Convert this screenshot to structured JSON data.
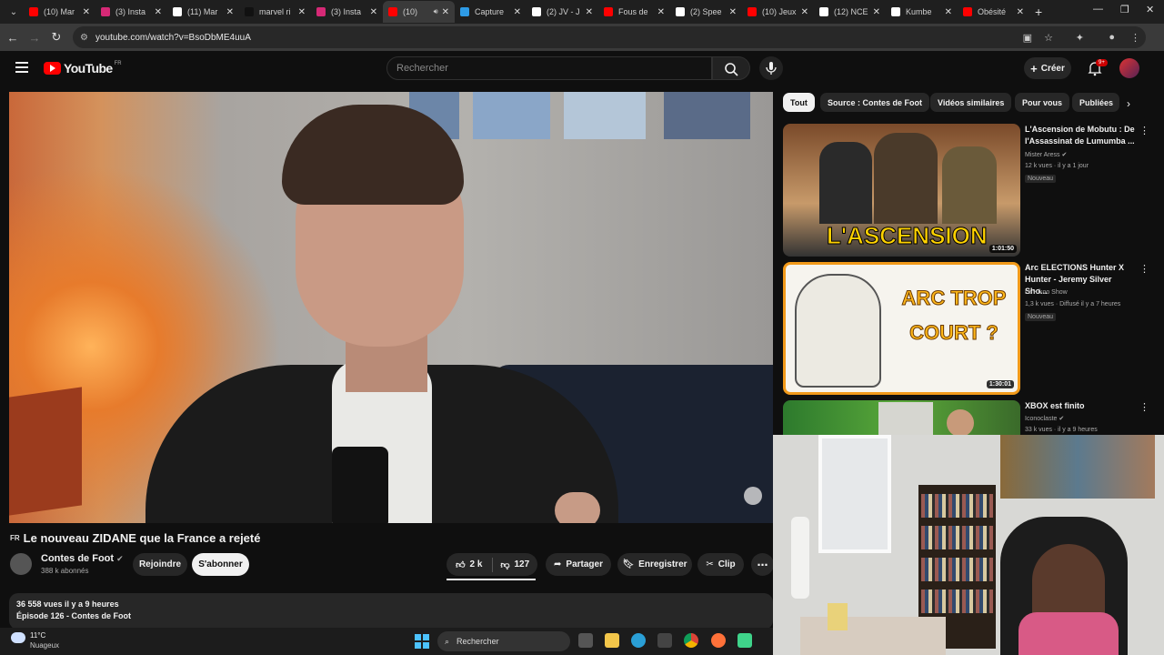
{
  "browser": {
    "tabs": [
      {
        "title": "(10) Mar",
        "color": "#ff0000"
      },
      {
        "title": "(3) Insta",
        "color": "#d62976"
      },
      {
        "title": "(11) Mar",
        "color": "#ffffff"
      },
      {
        "title": "marvel ri",
        "color": "#111111"
      },
      {
        "title": "(3) Insta",
        "color": "#d62976"
      },
      {
        "title": "(10) ",
        "color": "#ff0000",
        "active": true
      },
      {
        "title": "Capture",
        "color": "#2e9be6"
      },
      {
        "title": "(2) JV - J",
        "color": "#ffffff"
      },
      {
        "title": "Fous de",
        "color": "#ff0000"
      },
      {
        "title": "(2) Spee",
        "color": "#ffffff"
      },
      {
        "title": "(10) Jeux",
        "color": "#ff0000"
      },
      {
        "title": "(12) NCE",
        "color": "#ffffff"
      },
      {
        "title": "Kumbe",
        "color": "#ffffff"
      },
      {
        "title": "Obésité",
        "color": "#ff0000"
      }
    ],
    "url": "youtube.com/watch?v=BsoDbME4uuA"
  },
  "header": {
    "logo_text": "YouTube",
    "logo_country": "FR",
    "search_placeholder": "Rechercher",
    "create_label": "Créer",
    "notif_count": "9+"
  },
  "video": {
    "lang_badge": "FR",
    "title": "Le nouveau ZIDANE que la France a rejeté",
    "channel": "Contes de Foot",
    "subscribers": "388 k abonnés",
    "join_label": "Rejoindre",
    "subscribe_label": "S'abonner",
    "likes": "2 k",
    "dislikes": "127",
    "share_label": "Partager",
    "save_label": "Enregistrer",
    "clip_label": "Clip",
    "views_line": "36 558 vues  il y a 9 heures",
    "episode_line": "Épisode 126 - Contes de Foot"
  },
  "chips": [
    "Tout",
    "Source : Contes de Foot",
    "Vidéos similaires",
    "Pour vous",
    "Publiées"
  ],
  "recommendations": [
    {
      "title": "L'Ascension de Mobutu : De l'Assassinat de Lumumba ...",
      "channel": "Mister Aress",
      "meta": "12 k vues · il y a 1 jour",
      "badge": "Nouveau",
      "duration": "1:01:50",
      "thumb_text": "L'ASCENSION"
    },
    {
      "title": "Arc ELECTIONS Hunter X Hunter - Jeremy Silver Sho...",
      "channel": "Le Kikoo Show",
      "meta": "1,3 k vues · Diffusé il y a 7 heures",
      "badge": "Nouveau",
      "duration": "1:30:01",
      "thumb_text": "ARC TROP COURT ?"
    },
    {
      "title": "XBOX est finito",
      "channel": "Iconoclaste",
      "meta": "33 k vues · il y a 9 heures",
      "badge": "",
      "duration": "",
      "thumb_text": ""
    }
  ],
  "taskbar": {
    "temperature": "11°C",
    "condition": "Nuageux",
    "search_label": "Rechercher"
  }
}
